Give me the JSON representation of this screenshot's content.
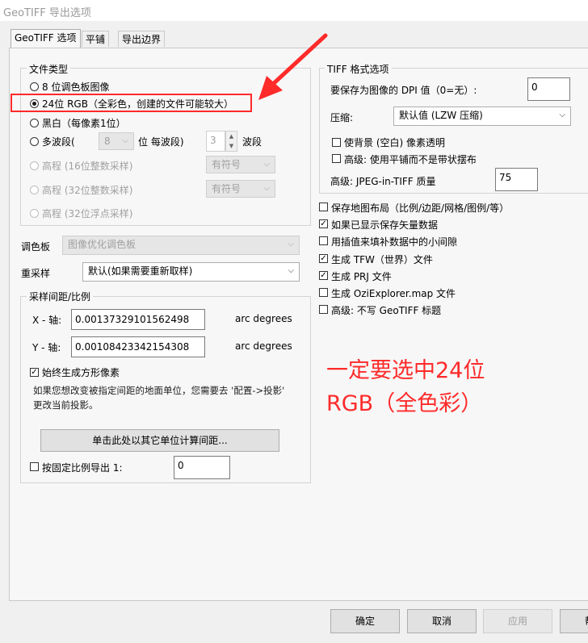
{
  "window": {
    "title": "GeoTIFF 导出选项"
  },
  "tabs": [
    {
      "label": "GeoTIFF 选项",
      "active": true
    },
    {
      "label": "平铺",
      "active": false
    },
    {
      "label": "导出边界",
      "active": false
    }
  ],
  "file_type": {
    "group_label": "文件类型",
    "options": [
      {
        "label": "8 位调色板图像",
        "selected": false,
        "enabled": true
      },
      {
        "label": "24位 RGB（全彩色，创建的文件可能较大）",
        "selected": true,
        "enabled": true
      },
      {
        "label": "黑白（每像素1位）",
        "selected": false,
        "enabled": true
      },
      {
        "label": "多波段(",
        "selected": false,
        "enabled": true
      },
      {
        "label": "高程 (16位整数采样)",
        "selected": false,
        "enabled": false
      },
      {
        "label": "高程 (32位整数采样)",
        "selected": false,
        "enabled": false
      },
      {
        "label": "高程 (32位浮点采样)",
        "selected": false,
        "enabled": false
      }
    ],
    "multiband_bits_value": "8",
    "multiband_bits_label": "位 每波段)",
    "multiband_count_value": "3",
    "multiband_count_label": "波段",
    "signed_16": "有符号",
    "signed_32": "有符号"
  },
  "palette": {
    "label": "调色板",
    "value": "图像优化调色板"
  },
  "resample": {
    "label": "重采样",
    "value": "默认(如果需要重新取样)"
  },
  "spacing": {
    "group_label": "采样间距/比例",
    "x_label": "X - 轴:",
    "x_value": "0.00137329101562498",
    "y_label": "Y - 轴:",
    "y_value": "0.00108423342154308",
    "units": "arc degrees",
    "square_label": "始终生成方形像素",
    "square_checked": true,
    "info_line1": "如果您想改变被指定间距的地面单位，您需要去 '配置->投影'",
    "info_line2": "更改当前投影。",
    "calc_button": "单击此处以其它单位计算间距...",
    "fixed_scale_label": "按固定比例导出 1:",
    "fixed_scale_value": "0",
    "fixed_scale_checked": false
  },
  "tiff": {
    "group_label": "TIFF 格式选项",
    "dpi_label": "要保存为图像的 DPI 值（0=无）:",
    "dpi_value": "0",
    "compress_label": "压缩:",
    "compress_value": "默认值 (LZW 压缩)",
    "transparent_label": "使背景 (空白) 像素透明",
    "tiled_label": "高级: 使用平铺而不是带状摆布",
    "jpeg_quality_label": "高级: JPEG-in-TIFF 质量",
    "jpeg_quality_value": "75"
  },
  "options": [
    {
      "label": "保存地图布局（比例/边距/网格/图例/等）",
      "checked": false
    },
    {
      "label": "如果已显示保存矢量数据",
      "checked": true
    },
    {
      "label": "用插值来填补数据中的小间隙",
      "checked": false
    },
    {
      "label": "生成 TFW（世界）文件",
      "checked": true
    },
    {
      "label": "生成 PRJ 文件",
      "checked": true
    },
    {
      "label": "生成 OziExplorer.map 文件",
      "checked": false
    },
    {
      "label": "高级: 不写 GeoTIFF 标题",
      "checked": false
    }
  ],
  "annotation": {
    "line1": "一定要选中24位",
    "line2": "RGB（全色彩）",
    "color": "#ff2a2a"
  },
  "buttons": {
    "ok": "确定",
    "cancel": "取消",
    "apply": "应用",
    "help": "帮"
  }
}
